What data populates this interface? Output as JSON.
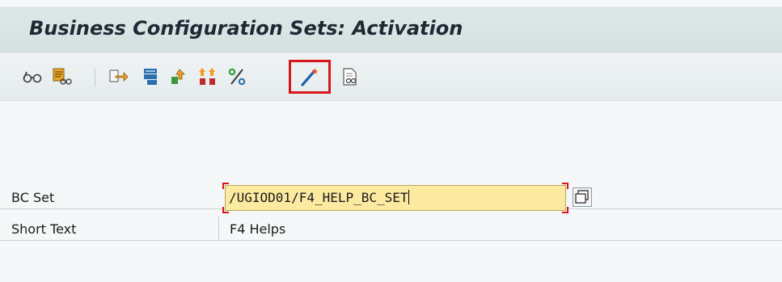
{
  "header": {
    "title": "Business Configuration Sets: Activation"
  },
  "toolbar": {
    "buttons": [
      {
        "icon": "glasses-display-icon"
      },
      {
        "icon": "display-details-icon"
      },
      {
        "icon": "transport-icon"
      },
      {
        "icon": "hierarchy-icon"
      },
      {
        "icon": "upload-icon"
      },
      {
        "icon": "sort-icon"
      },
      {
        "icon": "percent-icon"
      },
      {
        "icon": "activate-wand-icon",
        "highlighted": true,
        "highlight_color": "#d8171b"
      },
      {
        "icon": "document-icon"
      }
    ]
  },
  "form": {
    "bc_set_label": "BC Set",
    "bc_set_value": "/UGIOD01/F4_HELP_BC_SET",
    "short_text_label": "Short Text",
    "short_text_value": "F4 Helps"
  },
  "colors": {
    "title_bar": "#d6e0e1",
    "input_bg": "#fdeaa1",
    "highlight": "#d8171b"
  }
}
